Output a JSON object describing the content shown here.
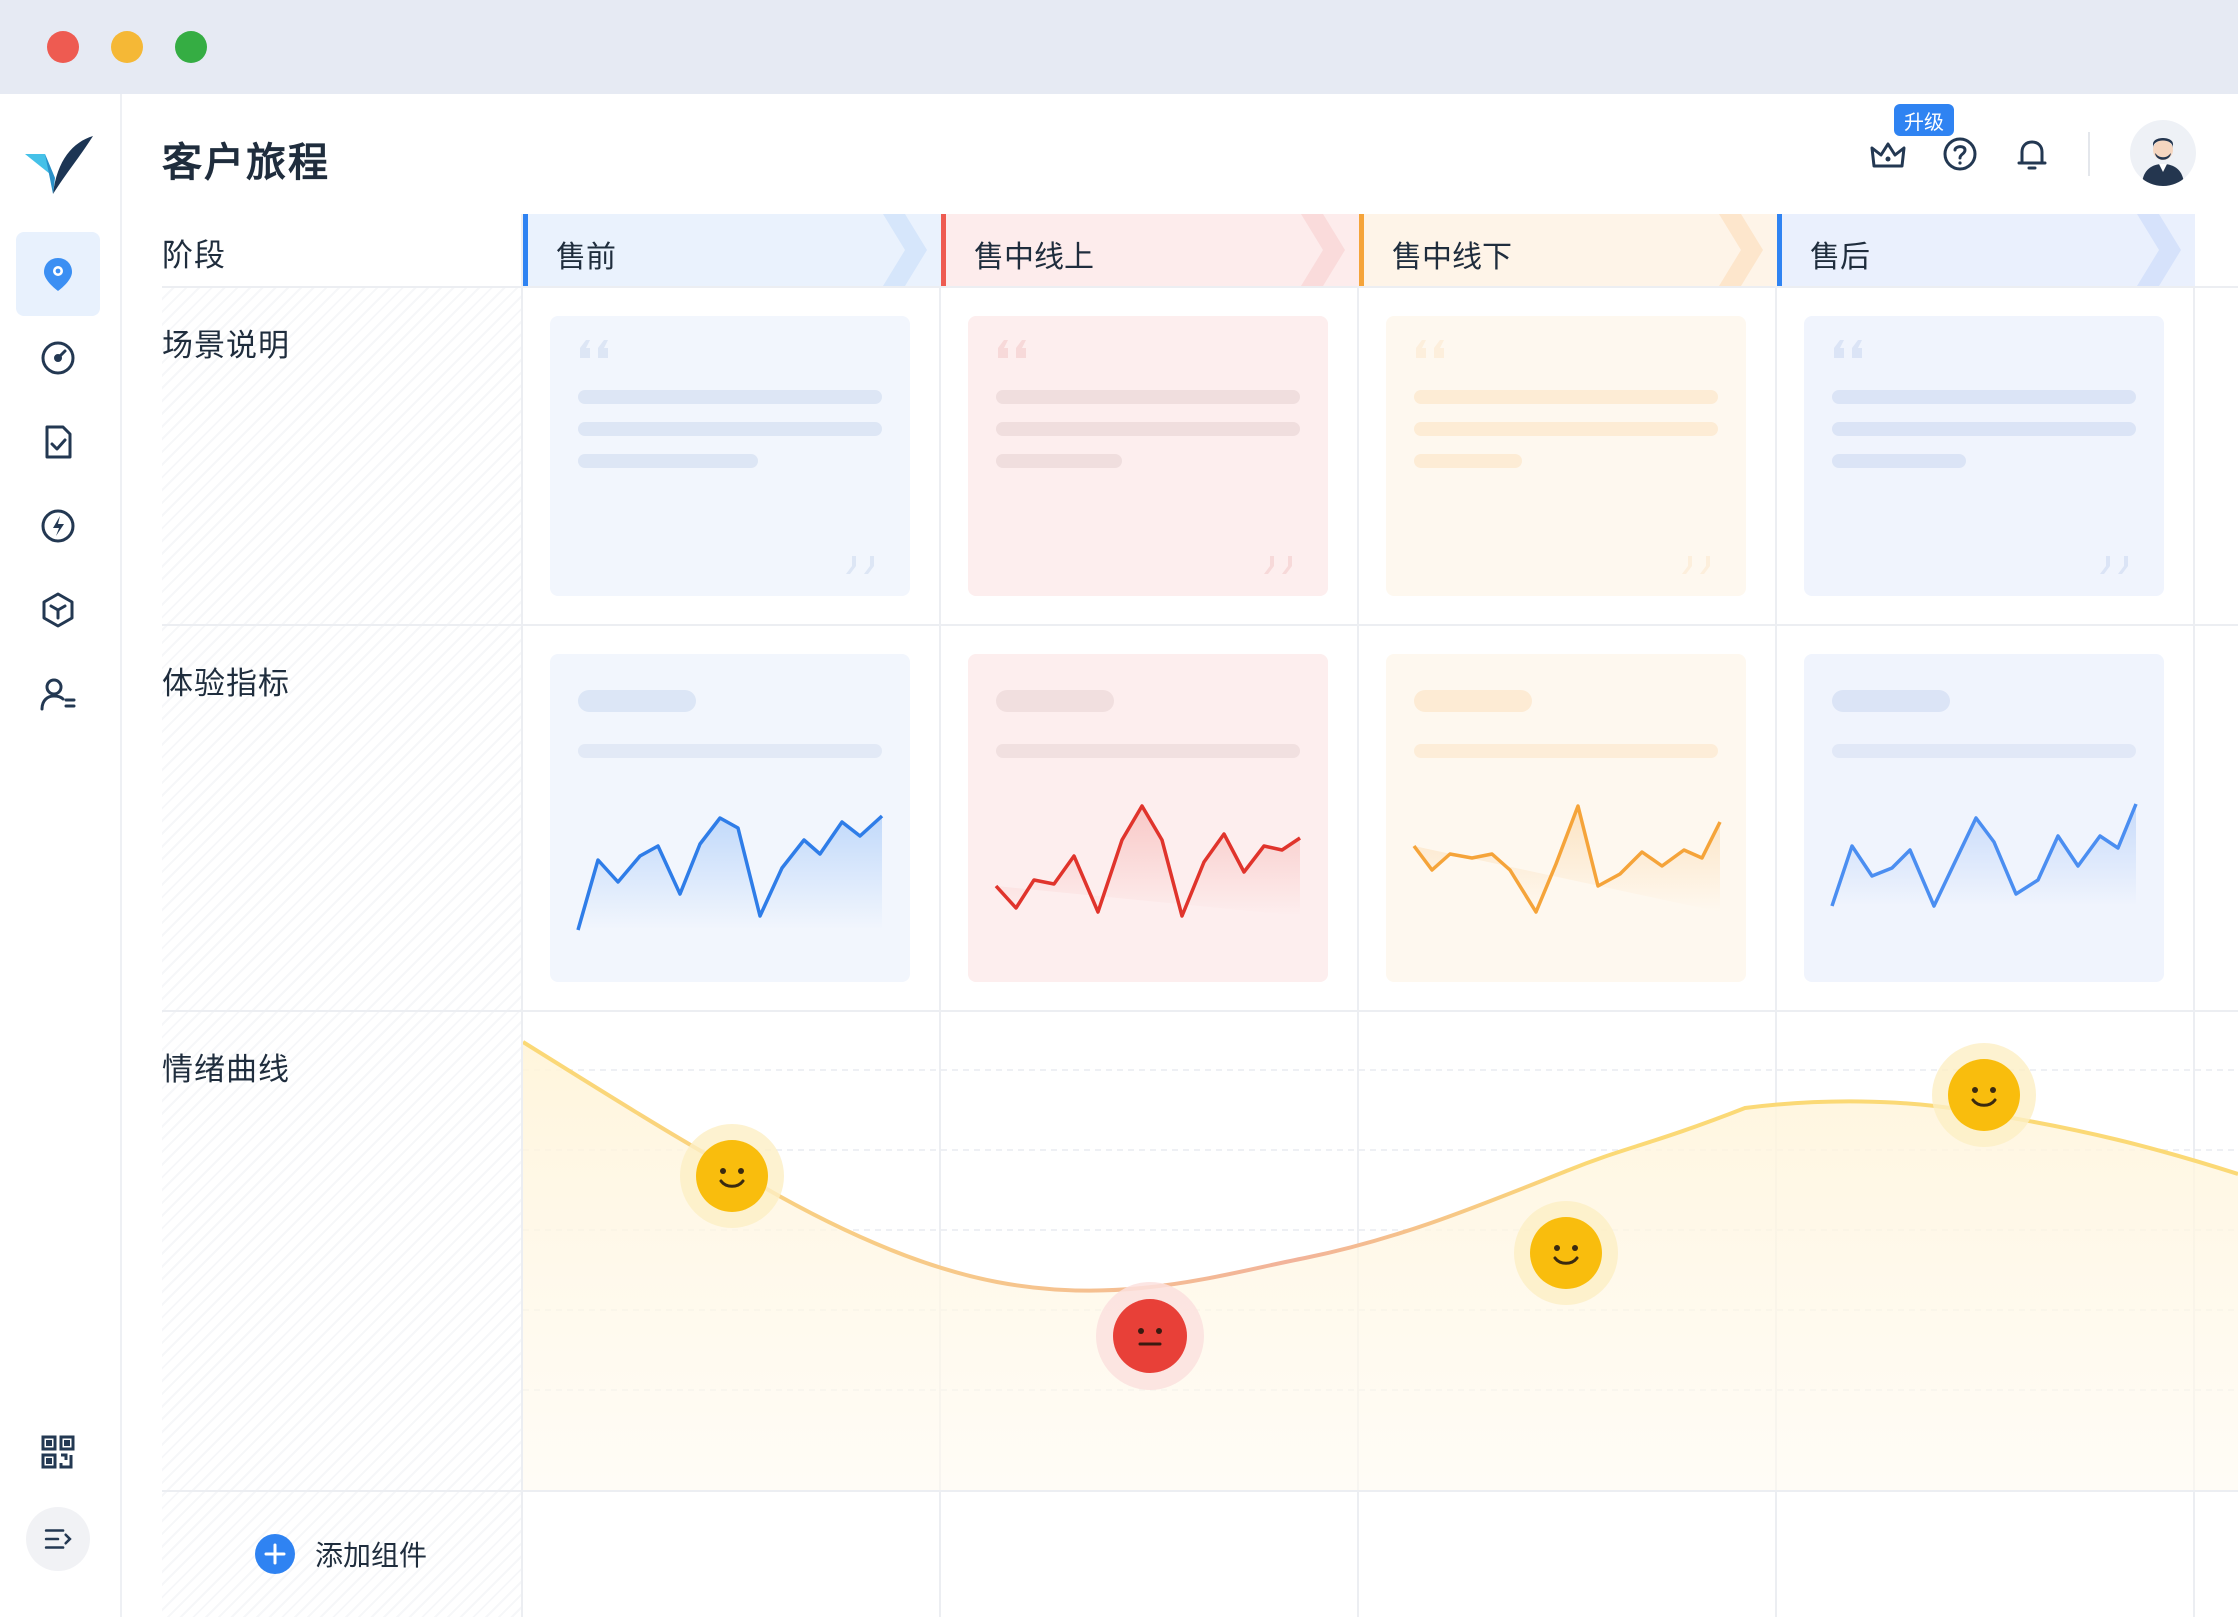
{
  "app": {
    "title": "客户旅程",
    "upgrade_badge": "升级",
    "accent_color": "#2f83f2"
  },
  "sidebar": {
    "items": [
      {
        "icon": "location-pin-icon",
        "active": true
      },
      {
        "icon": "dashboard-gauge-icon",
        "active": false
      },
      {
        "icon": "document-check-icon",
        "active": false
      },
      {
        "icon": "lightning-icon",
        "active": false
      },
      {
        "icon": "cube-icon",
        "active": false
      },
      {
        "icon": "user-list-icon",
        "active": false
      }
    ],
    "bottom": [
      {
        "icon": "qr-code-icon"
      },
      {
        "icon": "collapse-menu-icon"
      }
    ]
  },
  "header": {
    "icons": [
      "crown-icon",
      "help-icon",
      "bell-icon"
    ],
    "avatar": "user-avatar"
  },
  "board": {
    "row_labels": {
      "stage": "阶段",
      "scene": "场景说明",
      "metrics": "体验指标",
      "emotion": "情绪曲线"
    },
    "stages": [
      {
        "name": "售前",
        "color": "#2f83f2",
        "bg": "#eaf2fd",
        "emotion": "happy",
        "emotion_color": "#f9bd0d"
      },
      {
        "name": "售中线上",
        "color": "#ee5b51",
        "bg": "#fdecec",
        "emotion": "neutral",
        "emotion_color": "#e84038"
      },
      {
        "name": "售中线下",
        "color": "#f5a43a",
        "bg": "#fef4e8",
        "emotion": "happy",
        "emotion_color": "#f9bd0d"
      },
      {
        "name": "售后",
        "color": "#2f83f2",
        "bg": "#eaf0fd",
        "emotion": "happy",
        "emotion_color": "#f9bd0d"
      }
    ],
    "add_component": "添加组件"
  }
}
